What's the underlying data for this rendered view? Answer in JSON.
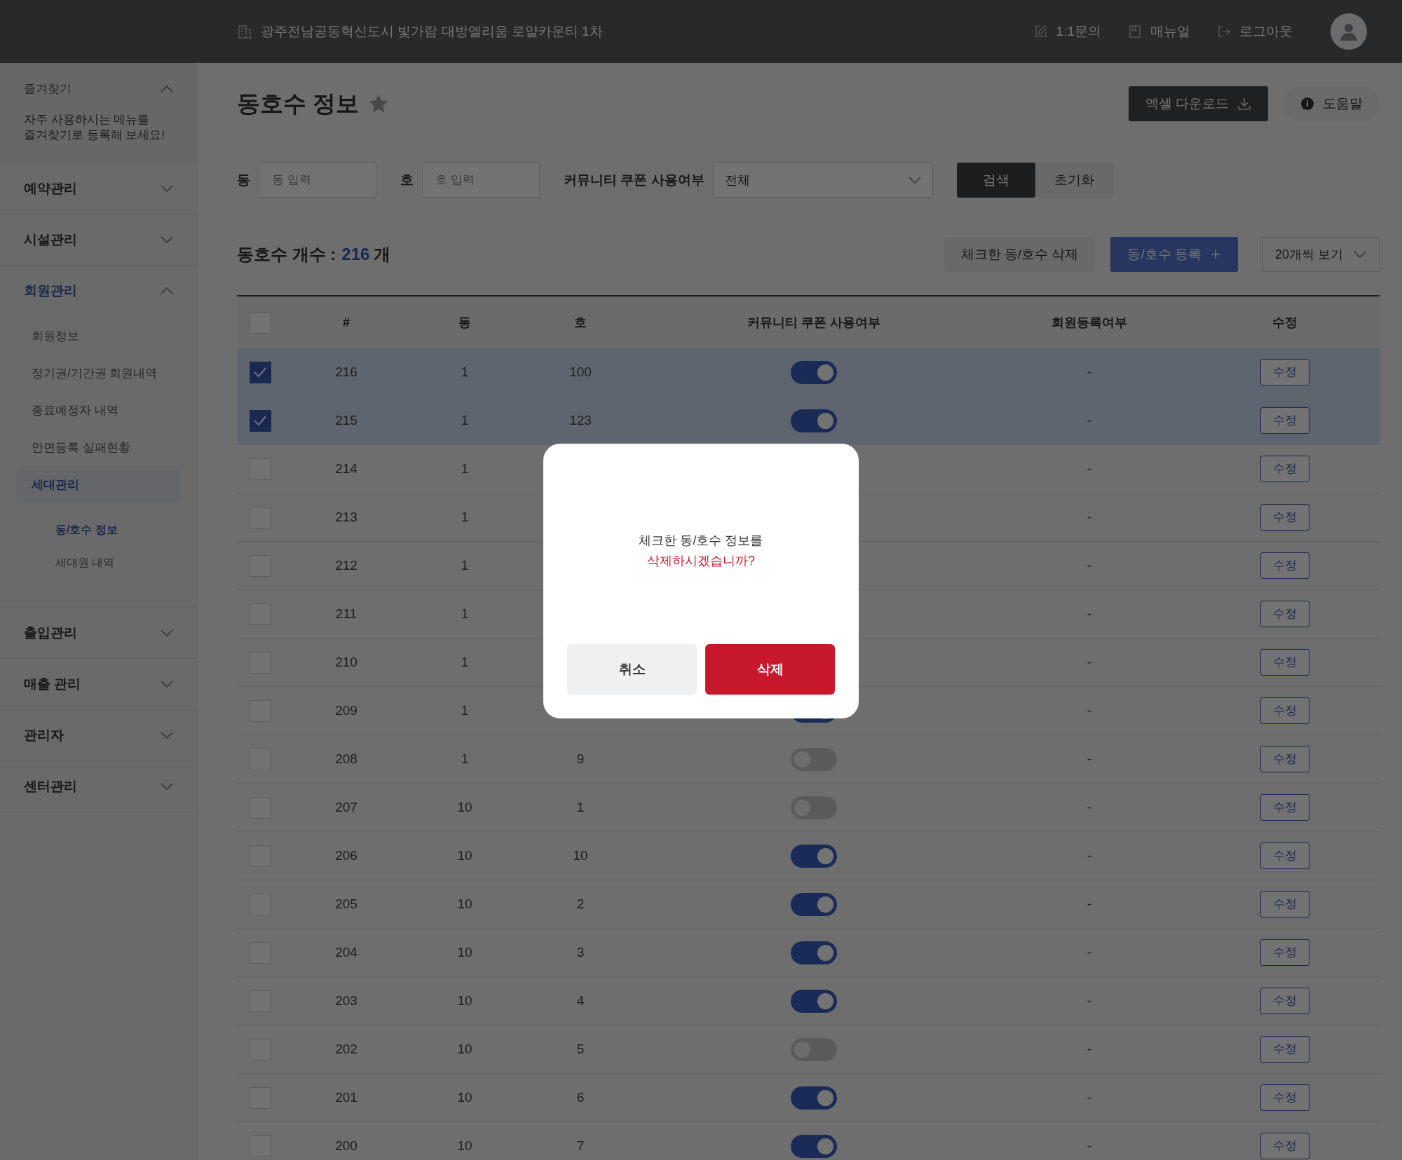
{
  "header": {
    "site": "광주전남공동혁신도시 빛가람 대방엘리움 로얄카운티 1차",
    "links": [
      {
        "kind": "inquiry",
        "label": "1:1문의"
      },
      {
        "kind": "manual",
        "label": "매뉴얼"
      },
      {
        "kind": "logout",
        "label": "로그아웃"
      }
    ]
  },
  "sidebar": {
    "favorites": {
      "title": "즐겨찾기",
      "expanded": true,
      "hint": "자주 사용하시는 메뉴를\n즐겨찾기로 등록해 보세요!"
    },
    "items": [
      {
        "label": "예약관리",
        "expanded": false,
        "selected": false
      },
      {
        "label": "시설관리",
        "expanded": false,
        "selected": false
      },
      {
        "label": "회원관리",
        "expanded": true,
        "selected": true,
        "children": [
          {
            "label": "회원정보",
            "selected": false
          },
          {
            "label": "정기권/기간권 회원내역",
            "selected": false
          },
          {
            "label": "종료예정자 내역",
            "selected": false
          },
          {
            "label": "안면등록 실패현황",
            "selected": false
          },
          {
            "label": "세대관리",
            "selected": true,
            "children": [
              {
                "label": "동/호수 정보",
                "selected": true
              },
              {
                "label": "세대원 내역",
                "selected": false
              }
            ]
          }
        ]
      },
      {
        "label": "출입관리",
        "expanded": false,
        "selected": false
      },
      {
        "label": "매출 관리",
        "expanded": false,
        "selected": false
      },
      {
        "label": "관리자",
        "expanded": false,
        "selected": false
      },
      {
        "label": "센터관리",
        "expanded": false,
        "selected": false
      }
    ]
  },
  "page": {
    "title": "동호수 정보",
    "starred": false,
    "excel_button": "엑셀 다운로드",
    "help_button": "도움말"
  },
  "filters": {
    "dong": {
      "label": "동",
      "placeholder": "동 입력"
    },
    "ho": {
      "label": "호",
      "placeholder": "호 입력"
    },
    "coupon": {
      "label": "커뮤니티 쿠폰 사용여부",
      "value": "전체"
    },
    "search_button": "검색",
    "reset_button": "초기화"
  },
  "summary": {
    "label": "동호수 개수 :",
    "count": "216",
    "unit": "개",
    "delete_button": "체크한 동/호수 삭제",
    "add_button": "동/호수 등록",
    "page_size": "20개씩 보기"
  },
  "table": {
    "columns": [
      "#",
      "동",
      "호",
      "커뮤니티 쿠폰 사용여부",
      "회원등록여부",
      "수정"
    ],
    "all_checked": false,
    "rows": [
      {
        "num": "216",
        "dong": "1",
        "ho": "100",
        "on": true,
        "member": "-",
        "edit": "수정",
        "checked": true
      },
      {
        "num": "215",
        "dong": "1",
        "ho": "123",
        "on": true,
        "member": "-",
        "edit": "수정",
        "checked": true
      },
      {
        "num": "214",
        "dong": "1",
        "member": "-",
        "edit": "수정",
        "checked": false
      },
      {
        "num": "213",
        "dong": "1",
        "member": "-",
        "edit": "수정",
        "checked": false
      },
      {
        "num": "212",
        "dong": "1",
        "member": "-",
        "edit": "수정",
        "checked": false
      },
      {
        "num": "211",
        "dong": "1",
        "member": "-",
        "edit": "수정",
        "checked": false
      },
      {
        "num": "210",
        "dong": "1",
        "member": "-",
        "edit": "수정",
        "checked": false
      },
      {
        "num": "209",
        "dong": "1",
        "on": true,
        "member": "-",
        "edit": "수정",
        "checked": false
      },
      {
        "num": "208",
        "dong": "1",
        "ho": "9",
        "on": false,
        "member": "-",
        "edit": "수정",
        "checked": false
      },
      {
        "num": "207",
        "dong": "10",
        "ho": "1",
        "on": false,
        "member": "-",
        "edit": "수정",
        "checked": false
      },
      {
        "num": "206",
        "dong": "10",
        "ho": "10",
        "on": true,
        "member": "-",
        "edit": "수정",
        "checked": false
      },
      {
        "num": "205",
        "dong": "10",
        "ho": "2",
        "on": true,
        "member": "-",
        "edit": "수정",
        "checked": false
      },
      {
        "num": "204",
        "dong": "10",
        "ho": "3",
        "on": true,
        "member": "-",
        "edit": "수정",
        "checked": false
      },
      {
        "num": "203",
        "dong": "10",
        "ho": "4",
        "on": true,
        "member": "-",
        "edit": "수정",
        "checked": false
      },
      {
        "num": "202",
        "dong": "10",
        "ho": "5",
        "on": false,
        "member": "-",
        "edit": "수정",
        "checked": false
      },
      {
        "num": "201",
        "dong": "10",
        "ho": "6",
        "on": true,
        "member": "-",
        "edit": "수정",
        "checked": false
      },
      {
        "num": "200",
        "dong": "10",
        "ho": "7",
        "on": true,
        "member": "-",
        "edit": "수정",
        "checked": false
      }
    ]
  },
  "dialog": {
    "message": "체크한 동/호수 정보를",
    "question": "삭제하시겠습니까?",
    "cancel_button": "취소",
    "confirm_button": "삭제"
  }
}
